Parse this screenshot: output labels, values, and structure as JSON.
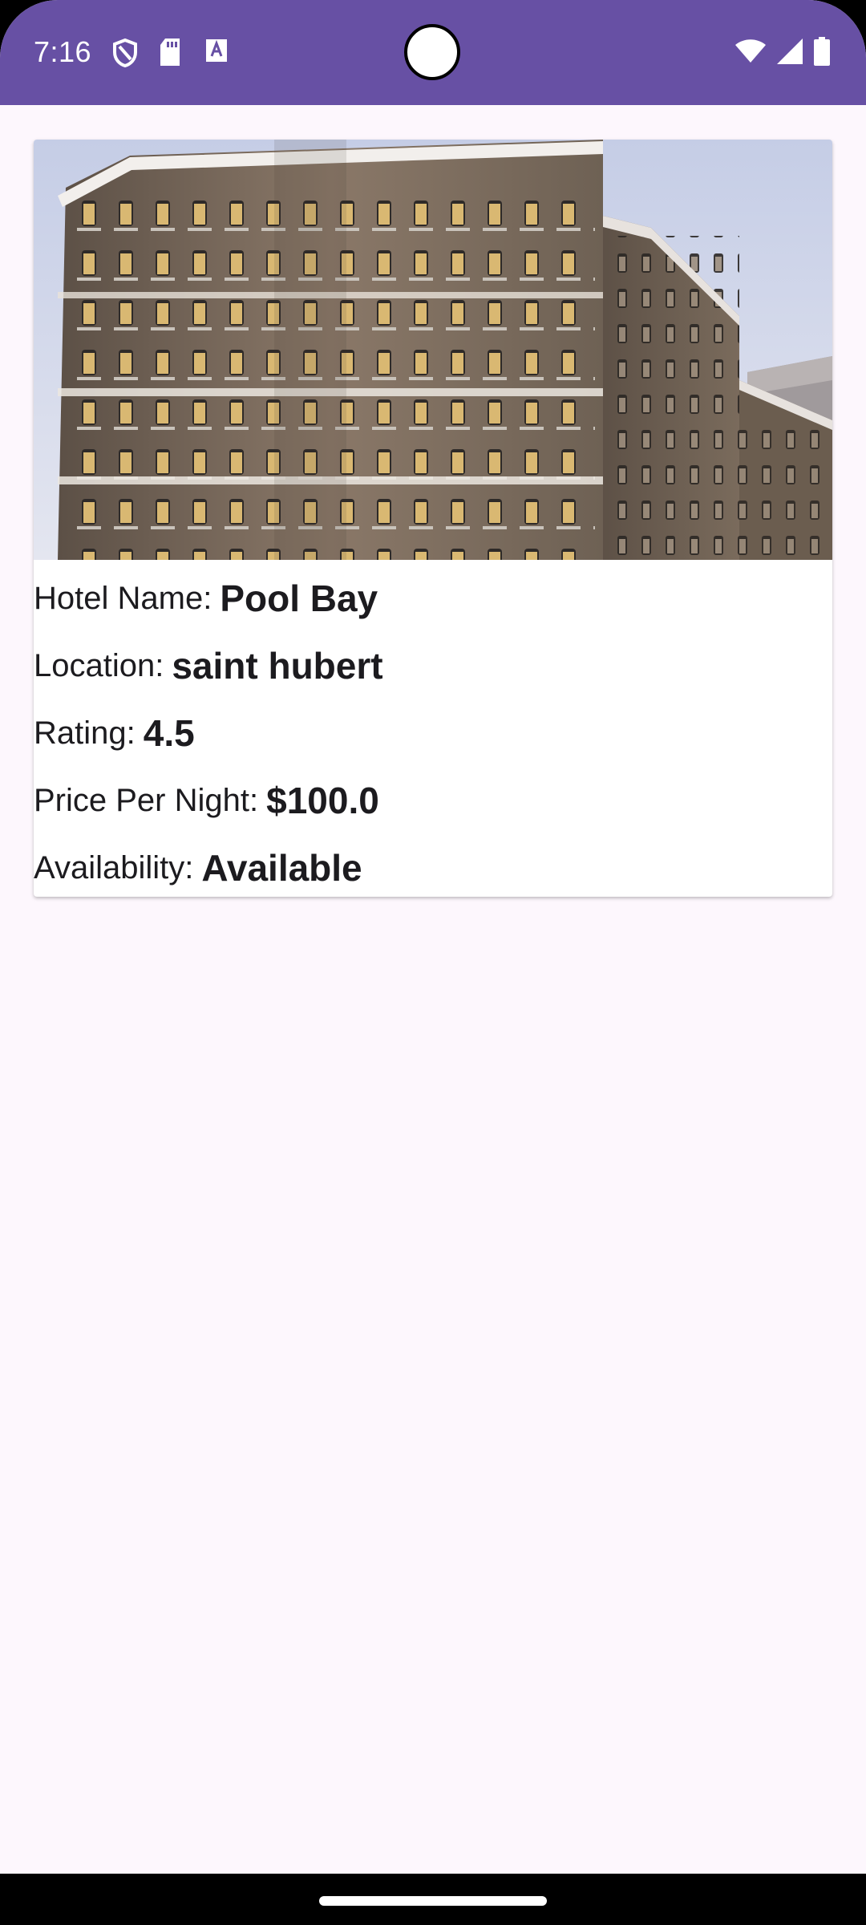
{
  "status_bar": {
    "time": "7:16",
    "icons_left": [
      "shield-icon",
      "sd-card-icon",
      "text-a-icon"
    ],
    "icons_right": [
      "wifi-icon",
      "cell-signal-icon",
      "battery-icon"
    ],
    "background": "#6750a4"
  },
  "hotel": {
    "image_alt": "Hotel building",
    "name_label": "Hotel Name:",
    "name_value": "Pool Bay",
    "location_label": "Location:",
    "location_value": "saint hubert",
    "rating_label": "Rating:",
    "rating_value": "4.5",
    "price_label": "Price Per Night:",
    "price_value": "$100.0",
    "availability_label": "Availability:",
    "availability_value": "Available"
  },
  "colors": {
    "accent": "#6750a4",
    "page_background": "#fdf7fd",
    "card_background": "#ffffff"
  }
}
